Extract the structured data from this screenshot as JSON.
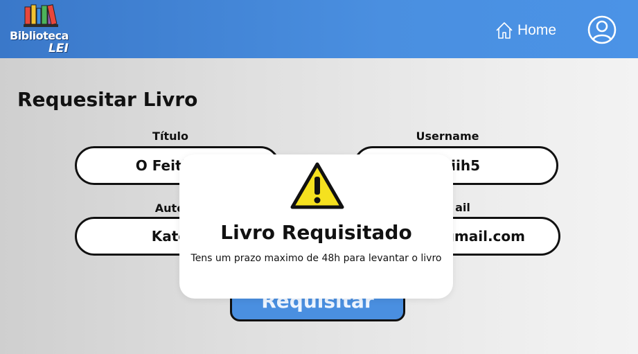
{
  "brand": {
    "line1": "Biblioteca",
    "line2": "LEI"
  },
  "nav": {
    "home_label": "Home"
  },
  "page": {
    "title": "Requesitar Livro"
  },
  "form": {
    "titulo_label": "Título",
    "titulo_value": "O Feitiço d",
    "username_label": "Username",
    "username_value": "iih5",
    "autor_label": "Auto",
    "autor_value": "Kate R",
    "email_label": "ail",
    "email_value": "@gmail.com",
    "submit_label": "Requisitar"
  },
  "modal": {
    "title": "Livro Requisitado",
    "message": "Tens um prazo maximo de 48h para levantar o livro",
    "icon": "warning-icon"
  },
  "colors": {
    "header": "#4a8fe0",
    "warning": "#f5e11f"
  }
}
